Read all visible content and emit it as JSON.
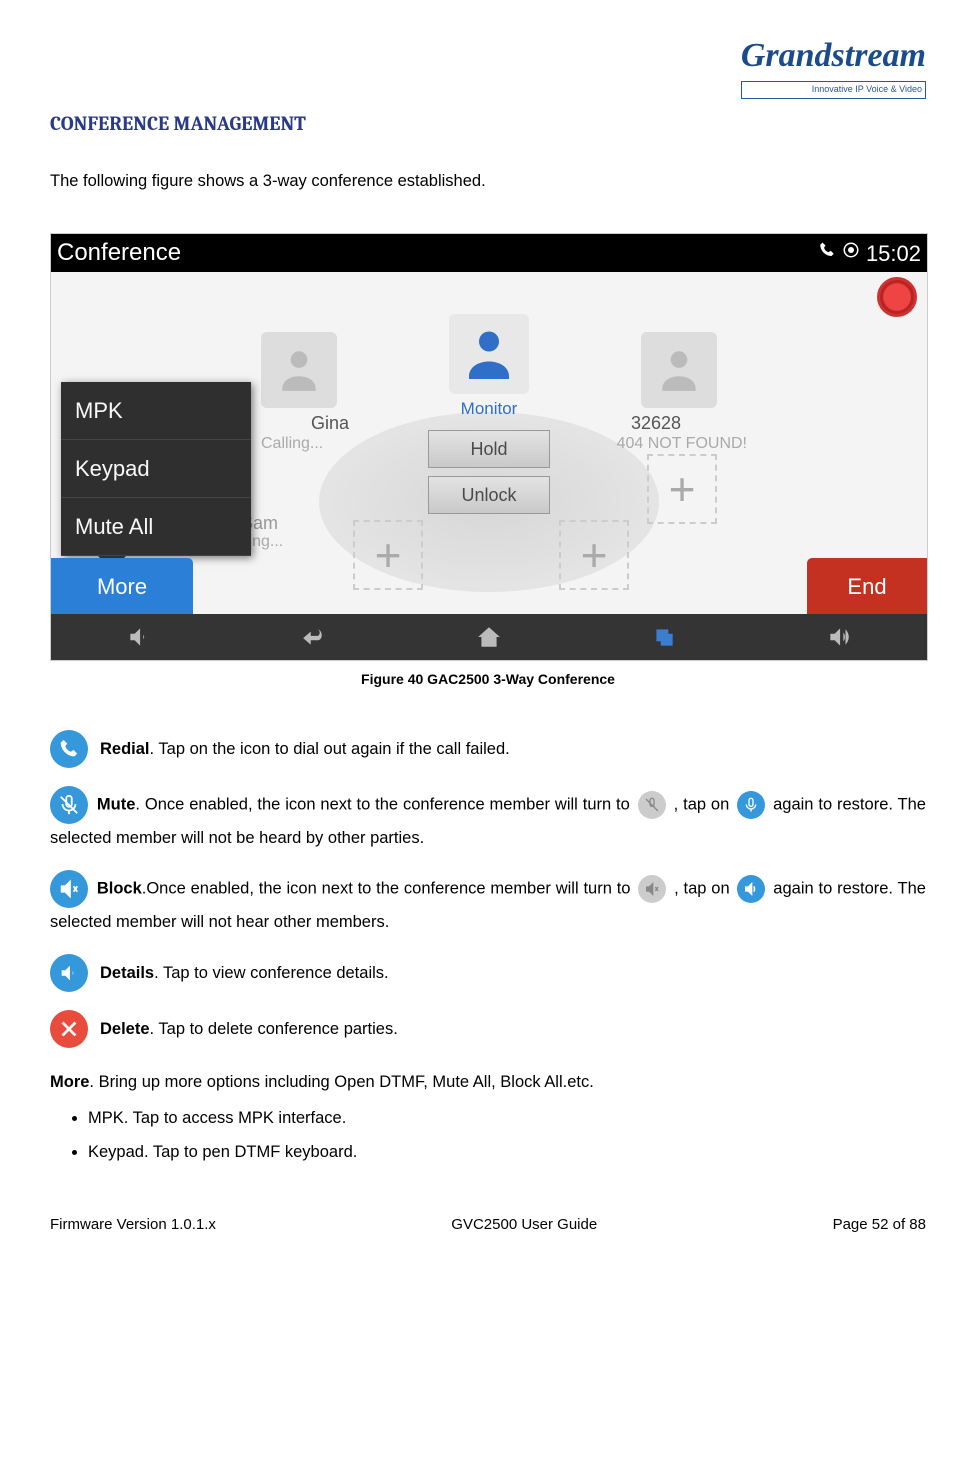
{
  "brand": {
    "name": "Grandstream",
    "tagline": "Innovative IP Voice & Video"
  },
  "heading": "CONFERENCE MANAGEMENT",
  "intro": "The following figure shows a 3-way conference established.",
  "screenshot": {
    "title": "Conference",
    "clock": "15:02",
    "center_user": "Monitor",
    "left_user_name": "Gina",
    "left_user_status": "Calling...",
    "bottom_user_name": "Sam",
    "bottom_user_status": "Calling...",
    "right_user_name": "32628",
    "right_user_status": "404 NOT FOUND!",
    "btn_hold": "Hold",
    "btn_unlock": "Unlock",
    "popup_items": [
      "MPK",
      "Keypad",
      "Mute All"
    ],
    "btn_more": "More",
    "btn_end": "End"
  },
  "caption": "Figure 40 GAC2500 3-Way Conference",
  "defs": {
    "redial_label": "Redial",
    "redial_text": ". Tap on the icon to dial out again if the call failed.",
    "mute_label": "Mute",
    "mute_text_1": ". Once enabled, the icon next to the conference member will turn to ",
    "mute_text_2": " , tap on ",
    "mute_text_3": "again to restore. The selected member will not be heard by other parties.",
    "block_label": "Block",
    "block_text_1": ".Once enabled, the icon next to the conference member will turn to ",
    "block_text_2": " , tap on ",
    "block_text_3": "again to restore. The selected member will not hear other members.",
    "details_label": "Details",
    "details_text": ". Tap to view conference details.",
    "delete_label": "Delete",
    "delete_text": ". Tap to delete conference parties."
  },
  "more_section": {
    "label": "More",
    "text": ". Bring up more options including Open DTMF, Mute All, Block All.etc.",
    "items": [
      "MPK. Tap to access MPK interface.",
      "Keypad. Tap to pen DTMF keyboard."
    ]
  },
  "footer": {
    "left": "Firmware Version 1.0.1.x",
    "center": "GVC2500 User Guide",
    "right": "Page 52 of 88"
  }
}
